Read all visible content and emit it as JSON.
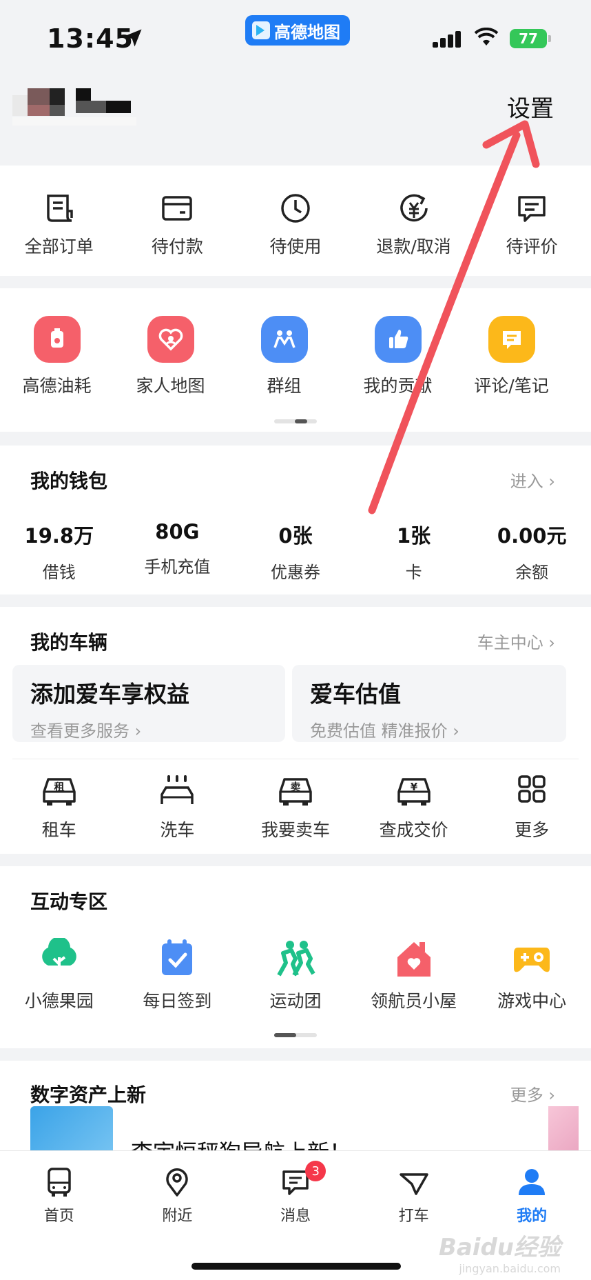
{
  "status_bar": {
    "time": "13:45",
    "app_badge": "高德地图",
    "battery": "77"
  },
  "header": {
    "settings_label": "设置"
  },
  "orders": [
    {
      "label": "全部订单",
      "icon": "receipt-icon"
    },
    {
      "label": "待付款",
      "icon": "wallet-card-icon"
    },
    {
      "label": "待使用",
      "icon": "clock-icon"
    },
    {
      "label": "退款/取消",
      "icon": "refund-icon"
    },
    {
      "label": "待评价",
      "icon": "comment-icon"
    }
  ],
  "tools": [
    {
      "label": "高德油耗",
      "icon": "fuel-icon",
      "color": "#f5606a"
    },
    {
      "label": "家人地图",
      "icon": "family-heart-icon",
      "color": "#f5606a"
    },
    {
      "label": "群组",
      "icon": "group-icon",
      "color": "#4d8ef5"
    },
    {
      "label": "我的贡献",
      "icon": "thumbs-up-icon",
      "color": "#4d8ef5"
    },
    {
      "label": "评论/笔记",
      "icon": "note-icon",
      "color": "#fcb81a"
    }
  ],
  "wallet": {
    "title": "我的钱包",
    "more": "进入",
    "items": [
      {
        "value": "19.8万",
        "label": "借钱"
      },
      {
        "value": "80G",
        "label": "手机充值"
      },
      {
        "value": "0张",
        "label": "优惠券"
      },
      {
        "value": "1张",
        "label": "卡"
      },
      {
        "value": "0.00元",
        "label": "余额"
      }
    ]
  },
  "vehicle": {
    "title": "我的车辆",
    "more": "车主中心",
    "promo_left": {
      "title": "添加爱车享权益",
      "sub": "查看更多服务"
    },
    "promo_right": {
      "title": "爱车估值",
      "sub": "免费估值 精准报价"
    },
    "services": [
      {
        "label": "租车",
        "glyph": "租",
        "icon": "car-rent-icon"
      },
      {
        "label": "洗车",
        "glyph": "",
        "icon": "car-wash-icon"
      },
      {
        "label": "我要卖车",
        "glyph": "卖",
        "icon": "car-sell-icon"
      },
      {
        "label": "查成交价",
        "glyph": "¥",
        "icon": "car-price-icon"
      },
      {
        "label": "更多",
        "glyph": "",
        "icon": "grid-icon"
      }
    ]
  },
  "interact": {
    "title": "互动专区",
    "items": [
      {
        "label": "小德果园",
        "icon": "tree-icon"
      },
      {
        "label": "每日签到",
        "icon": "calendar-check-icon"
      },
      {
        "label": "运动团",
        "icon": "running-icon"
      },
      {
        "label": "领航员小屋",
        "icon": "house-heart-icon"
      },
      {
        "label": "游戏中心",
        "icon": "gamepad-icon"
      }
    ]
  },
  "assets": {
    "title": "数字资产上新",
    "more": "更多",
    "item_title": "李宇恒秤狗导航上新！"
  },
  "tabbar": {
    "tabs": [
      {
        "label": "首页",
        "icon": "bus-icon"
      },
      {
        "label": "附近",
        "icon": "location-pin-icon"
      },
      {
        "label": "消息",
        "icon": "message-icon",
        "badge": "3"
      },
      {
        "label": "打车",
        "icon": "taxi-icon"
      },
      {
        "label": "我的",
        "icon": "person-icon"
      }
    ],
    "active": "我的",
    "active_color": "#1f7cf5"
  },
  "watermark": {
    "brand": "Baidu经验",
    "url": "jingyan.baidu.com"
  },
  "annotation_color": "#f0535b"
}
